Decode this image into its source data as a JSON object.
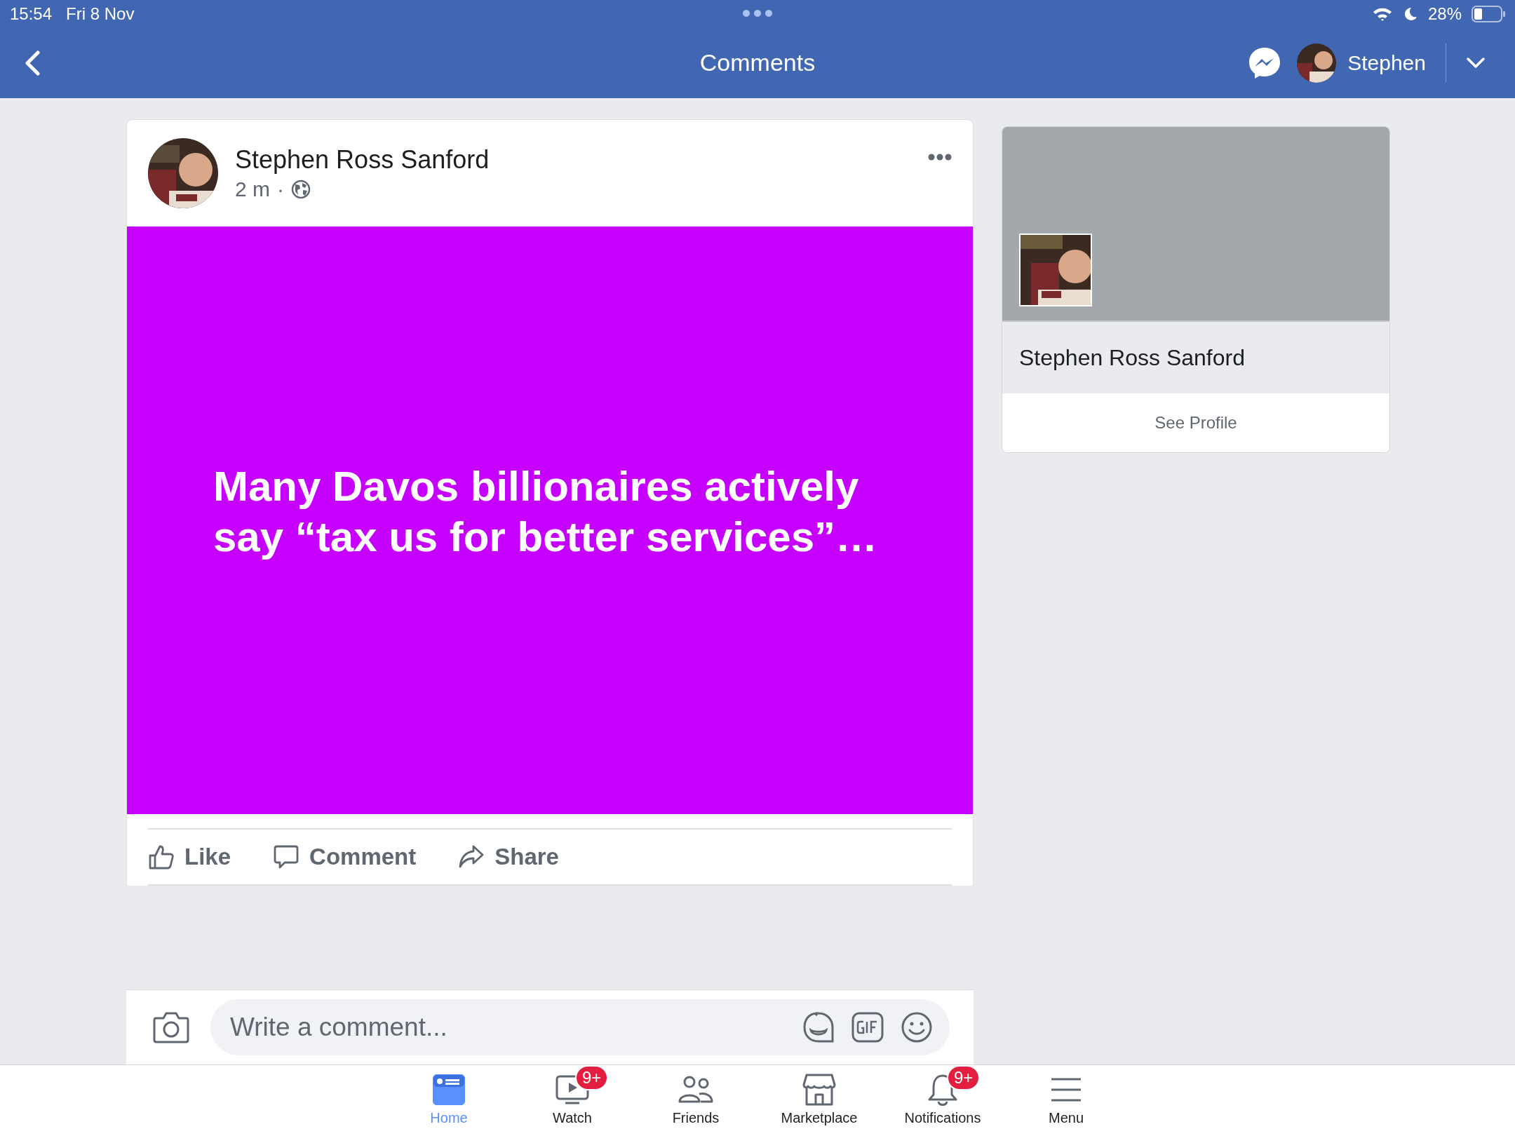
{
  "status_bar": {
    "time": "15:54",
    "date": "Fri 8 Nov",
    "battery": "28%"
  },
  "header": {
    "title": "Comments",
    "user_name": "Stephen"
  },
  "post": {
    "author": "Stephen Ross Sanford",
    "time": "2 m",
    "separator": "·",
    "text": "Many Davos billionaires actively say “tax us for better services”…",
    "actions": [
      {
        "kind": "like",
        "label": "Like"
      },
      {
        "kind": "comment",
        "label": "Comment"
      },
      {
        "kind": "share",
        "label": "Share"
      }
    ]
  },
  "profile_card": {
    "name": "Stephen Ross Sanford",
    "button": "See Profile"
  },
  "comment_bar": {
    "placeholder": "Write a comment..."
  },
  "nav": [
    {
      "kind": "home",
      "label": "Home",
      "selected": true
    },
    {
      "kind": "watch",
      "label": "Watch",
      "selected": false,
      "badge": "9+"
    },
    {
      "kind": "friends",
      "label": "Friends",
      "selected": false
    },
    {
      "kind": "marketplace",
      "label": "Marketplace",
      "selected": false
    },
    {
      "kind": "notifications",
      "label": "Notifications",
      "selected": false,
      "badge": "9+"
    },
    {
      "kind": "menu",
      "label": "Menu",
      "selected": false
    }
  ]
}
